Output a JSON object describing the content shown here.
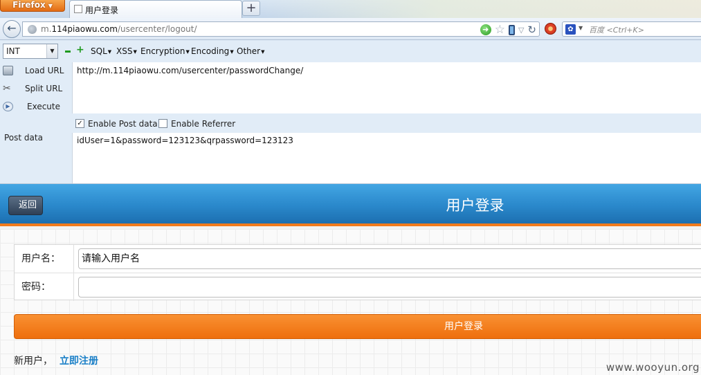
{
  "browser": {
    "menu_button": "Firefox",
    "tab_title": "用户登录",
    "new_tab": "+",
    "url_prefix": "m.",
    "url_host": "114piaowu.com",
    "url_path": "/usercenter/logout/",
    "search_placeholder": "百度 <Ctrl+K>"
  },
  "hackbar": {
    "select_value": "INT",
    "menus": [
      "SQL",
      "XSS",
      "Encryption",
      "Encoding",
      "Other"
    ],
    "load_url": "Load URL",
    "split_url": "Split URL",
    "execute": "Execute",
    "url_value": "http://m.114piaowu.com/usercenter/passwordChange/",
    "enable_post": "Enable Post data",
    "enable_post_checked": true,
    "enable_referrer": "Enable Referrer",
    "enable_referrer_checked": false,
    "post_label": "Post data",
    "post_value": "idUser=1&password=123123&qrpassword=123123"
  },
  "page": {
    "back_label": "返回",
    "title": "用户登录",
    "username_label": "用户名：",
    "username_placeholder": "请输入用户名",
    "password_label": "密码：",
    "password_value": "",
    "login_button": "用户登录",
    "new_user_text": "新用户，",
    "register_link": "立即注册",
    "accent_color": "#f07a1c",
    "header_color": "#2a88cb"
  },
  "watermark": "www.wooyun.org"
}
